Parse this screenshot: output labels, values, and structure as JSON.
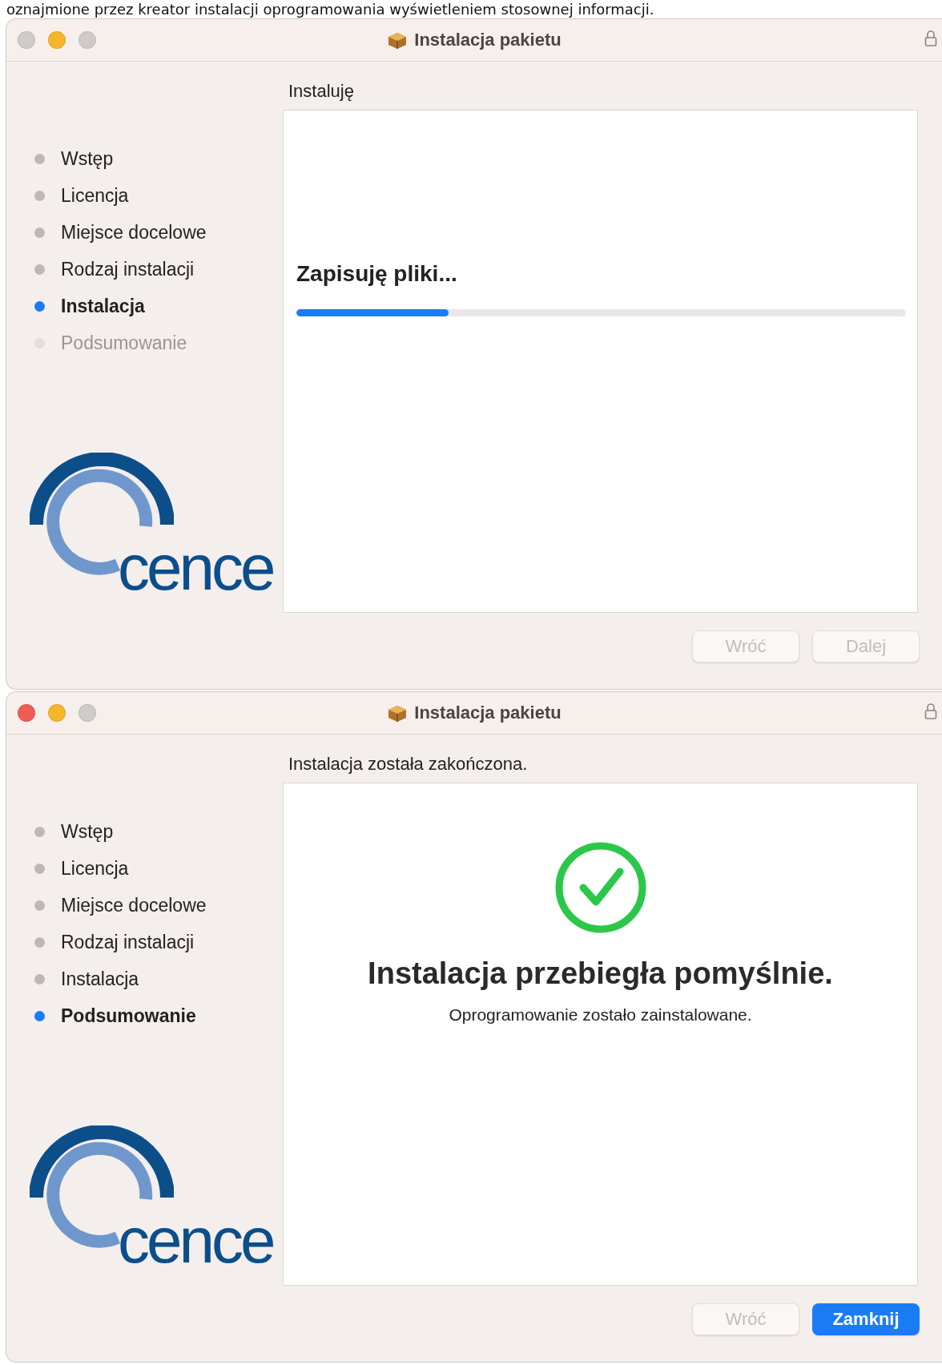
{
  "caption": "oznajmione przez kreator instalacji oprogramowania wyświetleniem stosownej informacji.",
  "windows": [
    {
      "title": "Instalacja pakietu",
      "lights": [
        {
          "color": "#cfcbc8"
        },
        {
          "color": "#f6b62c"
        },
        {
          "color": "#cfcbc8"
        }
      ],
      "logo": "cence",
      "steps": [
        {
          "label": "Wstęp",
          "selected": false,
          "disabled": false
        },
        {
          "label": "Licencja",
          "selected": false,
          "disabled": false
        },
        {
          "label": "Miejsce docelowe",
          "selected": false,
          "disabled": false
        },
        {
          "label": "Rodzaj instalacji",
          "selected": false,
          "disabled": false
        },
        {
          "label": "Instalacja",
          "selected": true,
          "disabled": false
        },
        {
          "label": "Podsumowanie",
          "selected": false,
          "disabled": true
        }
      ],
      "heading": "Instaluję",
      "content": {
        "kind": "progress",
        "status": "Zapisuję pliki...",
        "level": 0.25
      },
      "buttons": [
        {
          "label": "Wróć",
          "disabled": true,
          "primary": false
        },
        {
          "label": "Dalej",
          "disabled": true,
          "primary": false
        }
      ]
    },
    {
      "title": "Instalacja pakietu",
      "lights": [
        {
          "color": "#f05d54"
        },
        {
          "color": "#f6b62c"
        },
        {
          "color": "#cfcbc8"
        }
      ],
      "logo": "cence",
      "steps": [
        {
          "label": "Wstęp",
          "selected": false,
          "disabled": false
        },
        {
          "label": "Licencja",
          "selected": false,
          "disabled": false
        },
        {
          "label": "Miejsce docelowe",
          "selected": false,
          "disabled": false
        },
        {
          "label": "Rodzaj instalacji",
          "selected": false,
          "disabled": false
        },
        {
          "label": "Instalacja",
          "selected": false,
          "disabled": false
        },
        {
          "label": "Podsumowanie",
          "selected": true,
          "disabled": false
        }
      ],
      "heading": "Instalacja została zakończona.",
      "content": {
        "kind": "success",
        "title": "Instalacja przebiegła pomyślnie.",
        "message": "Oprogramowanie zostało zainstalowane."
      },
      "buttons": [
        {
          "label": "Wróć",
          "disabled": true,
          "primary": false
        },
        {
          "label": "Zamknij",
          "disabled": false,
          "primary": true
        }
      ]
    }
  ]
}
